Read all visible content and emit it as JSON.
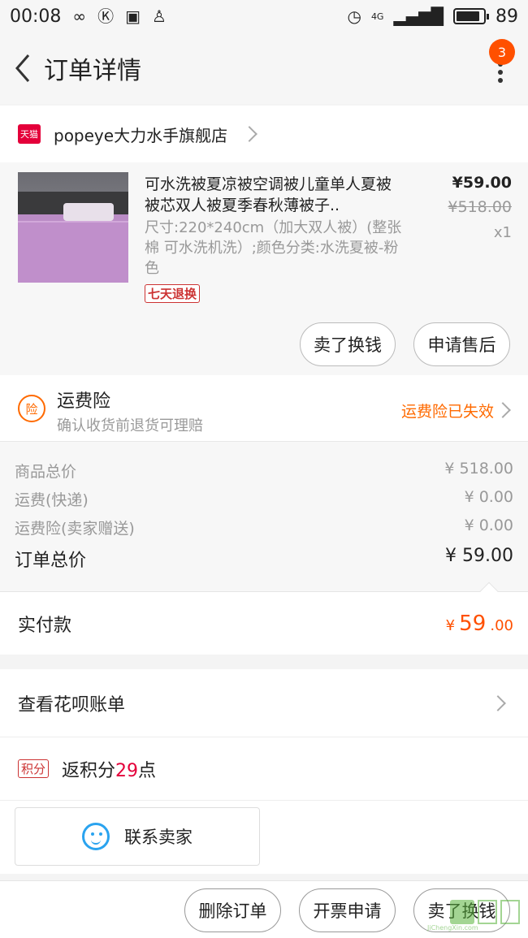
{
  "status_bar": {
    "time": "00:08",
    "network": "4G",
    "battery": "89",
    "battery_fraction": 0.89
  },
  "nav": {
    "title": "订单详情",
    "badge_count": "3"
  },
  "shop": {
    "badge_text": "天猫",
    "name": "popeye大力水手旗舰店"
  },
  "item": {
    "title": "可水洗被夏凉被空调被儿童单人夏被被芯双人被夏季春秋薄被子..",
    "spec": "尺寸:220*240cm（加大双人被）(整张棉 可水洗机洗）;颜色分类:水洗夏被-粉色",
    "tag": "七天退换",
    "price": "¥59.00",
    "original_price": "¥518.00",
    "quantity": "x1",
    "actions": [
      "卖了换钱",
      "申请售后"
    ]
  },
  "insurance": {
    "icon_text": "险",
    "title": "运费险",
    "subtitle": "确认收货前退货可理赔",
    "status": "运费险已失效"
  },
  "summary": {
    "rows": [
      {
        "label": "商品总价",
        "value": "¥ 518.00"
      },
      {
        "label": "运费(快递)",
        "value": "¥ 0.00"
      },
      {
        "label": "运费险(卖家赠送)",
        "value": "¥ 0.00"
      }
    ],
    "total_label": "订单总价",
    "total_value": "¥ 59.00"
  },
  "paid": {
    "label": "实付款",
    "currency": "¥",
    "integer": "59",
    "decimal": ".00"
  },
  "huabei": {
    "label": "查看花呗账单"
  },
  "points": {
    "tag": "积分",
    "prefix": "返积分",
    "number": "29",
    "suffix": "点"
  },
  "contact": {
    "label": "联系卖家"
  },
  "bottom_actions": [
    "删除订单",
    "开票申请",
    "卖了换钱"
  ],
  "watermark": {
    "text": "JiChengXin.com"
  },
  "colors": {
    "accent": "#ff5000",
    "tmall_red": "#e4003a",
    "wangwang_blue": "#2aa3ef"
  }
}
